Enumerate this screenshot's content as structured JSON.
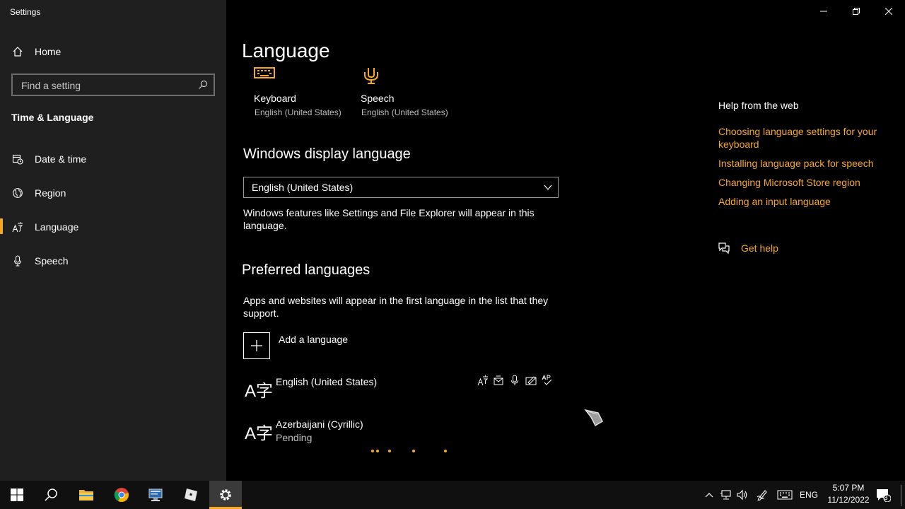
{
  "window": {
    "title": "Settings"
  },
  "sidebar": {
    "home_label": "Home",
    "search_placeholder": "Find a setting",
    "section_title": "Time & Language",
    "items": [
      {
        "label": "Date & time",
        "icon": "calendar-clock-icon"
      },
      {
        "label": "Region",
        "icon": "globe-icon"
      },
      {
        "label": "Language",
        "icon": "language-icon",
        "selected": true
      },
      {
        "label": "Speech",
        "icon": "microphone-icon"
      }
    ]
  },
  "main": {
    "title": "Language",
    "tiles": [
      {
        "label": "Keyboard",
        "sub": "English (United States)",
        "icon": "keyboard-icon"
      },
      {
        "label": "Speech",
        "sub": "English (United States)",
        "icon": "microphone-icon"
      }
    ],
    "display_language": {
      "heading": "Windows display language",
      "selected": "English (United States)",
      "description": "Windows features like Settings and File Explorer will appear in this language."
    },
    "preferred": {
      "heading": "Preferred languages",
      "description": "Apps and websites will appear in the first language in the list that they support.",
      "add_label": "Add a language",
      "languages": [
        {
          "name": "English (United States)",
          "sub": ""
        },
        {
          "name": "Azerbaijani (Cyrillic)",
          "sub": "Pending"
        }
      ],
      "language_glyph": "A字"
    }
  },
  "help": {
    "title": "Help from the web",
    "links": [
      "Choosing language settings for your keyboard",
      "Installing language pack for speech",
      "Changing Microsoft Store region",
      "Adding an input language"
    ],
    "get_help": "Get help"
  },
  "taskbar": {
    "input_indicator": "ENG",
    "time": "5:07 PM",
    "date": "11/12/2022",
    "notification_count": "3"
  },
  "colors": {
    "accent": "#f7a823",
    "sidebar_bg": "#1f1f1f",
    "main_bg": "#000000"
  }
}
